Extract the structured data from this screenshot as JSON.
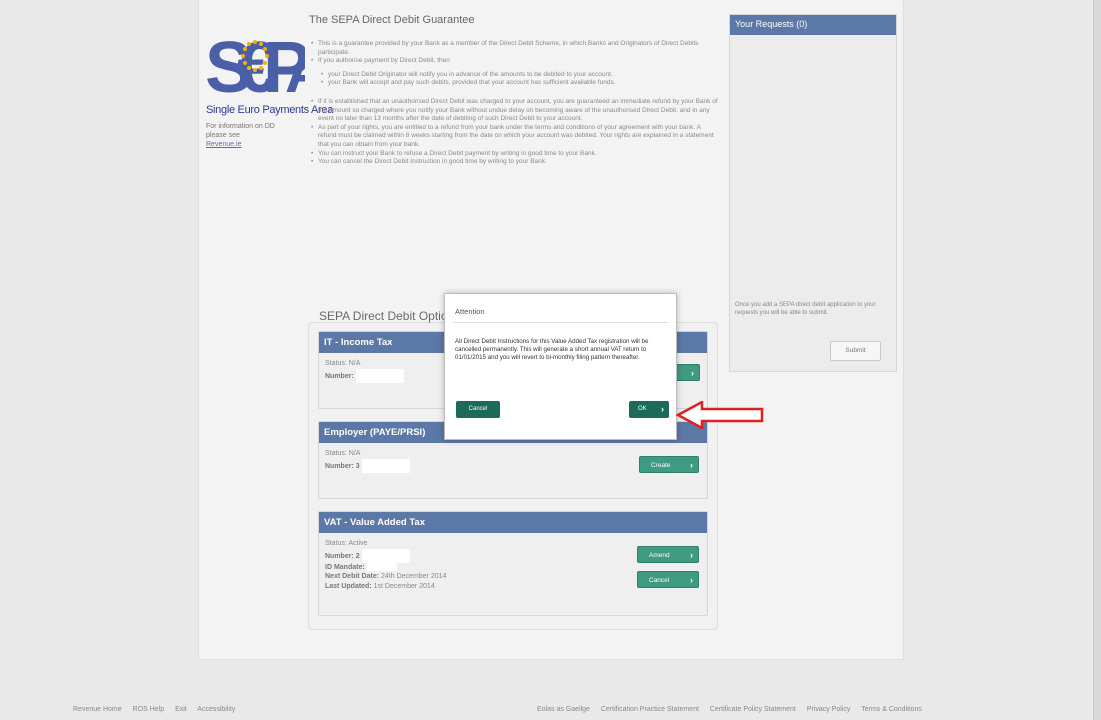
{
  "logo": {
    "letters": "SEPA",
    "subtitle": "Single Euro Payments Area",
    "info_line1": "For information on DD",
    "info_line2": "please see",
    "info_link": "Revenue.ie"
  },
  "guarantee": {
    "title": "The SEPA Direct Debit Guarantee",
    "items": [
      "This is a guarantee provided by your Bank as a member of the Direct Debit Scheme, in which Banks and Originators of Direct Debits participate.",
      "If you authorise payment by Direct Debit, then",
      "your Direct Debit Originator will notify you in advance of the amounts to be debited to your account.",
      "your Bank will accept and pay such debits, provided that your account has sufficient available funds.",
      "If it is established that an unauthorised Direct Debit was charged to your account, you are guaranteed an immediate refund by your Bank of the amount so charged where you notify your Bank without undue delay on becoming aware of the unauthorised Direct Debit, and in any event no later than 13 months after the date of debiting of such Direct Debit to your account.",
      "As part of your rights, you are entitled to a refund from your bank under the terms and conditions of your agreement with your bank. A refund must be claimed within 8 weeks starting from the date on which your account was debited. Your rights are explained in a statement that you can obtain from your bank.",
      "You can instruct your Bank to refuse a Direct Debit payment by writing in good time to your Bank.",
      "You can cancel the Direct Debit Instruction in good time by writing to your Bank."
    ]
  },
  "requests": {
    "title": "Your Requests (0)",
    "help": "Once you add a SEPA direct debit application to your requests you will be able to submit.",
    "submit_label": "Submit"
  },
  "options": {
    "title": "SEPA Direct Debit Options",
    "cards": [
      {
        "title": "IT - Income Tax",
        "status_label": "Status:",
        "status": "N/A",
        "number_label": "Number:",
        "number": "",
        "button": ""
      },
      {
        "title": "Employer (PAYE/PRSI)",
        "status_label": "Status:",
        "status": "N/A",
        "number_label": "Number:",
        "number": "3",
        "button": "Create"
      },
      {
        "title": "VAT - Value Added Tax",
        "status_label": "Status:",
        "status": "Active",
        "number_label": "Number:",
        "number": "2",
        "mandate_label": "ID Mandate:",
        "mandate": "",
        "next_debit_label": "Next Debit Date:",
        "next_debit": "24th December 2014",
        "updated_label": "Last Updated:",
        "updated": "1st December 2014",
        "amend_label": "Amend",
        "cancel_label": "Cancel"
      }
    ]
  },
  "modal": {
    "title": "Attention",
    "message": "All Direct Debit Instructions for this Value Added Tax registration will be cancelled permanently. This will generate a short annual VAT return to 01/01/2015 and you will revert to bi-monthly filing pattern thereafter.",
    "cancel_label": "Cancel",
    "ok_label": "OK"
  },
  "footer": {
    "left": [
      "Revenue Home",
      "ROS Help",
      "Exit",
      "Accessibility"
    ],
    "right": [
      "Eolas as Gaeilge",
      "Certification Practice Statement",
      "Certificate Policy Statement",
      "Privacy Policy",
      "Terms & Conditions"
    ]
  },
  "colors": {
    "panel_header": "#5c78a6",
    "teal_button": "#3f9a82",
    "modal_button": "#1c6b58",
    "annotation_arrow": "#e02020",
    "logo_blue": "#2d3b8d",
    "logo_gold": "#f0b400"
  }
}
